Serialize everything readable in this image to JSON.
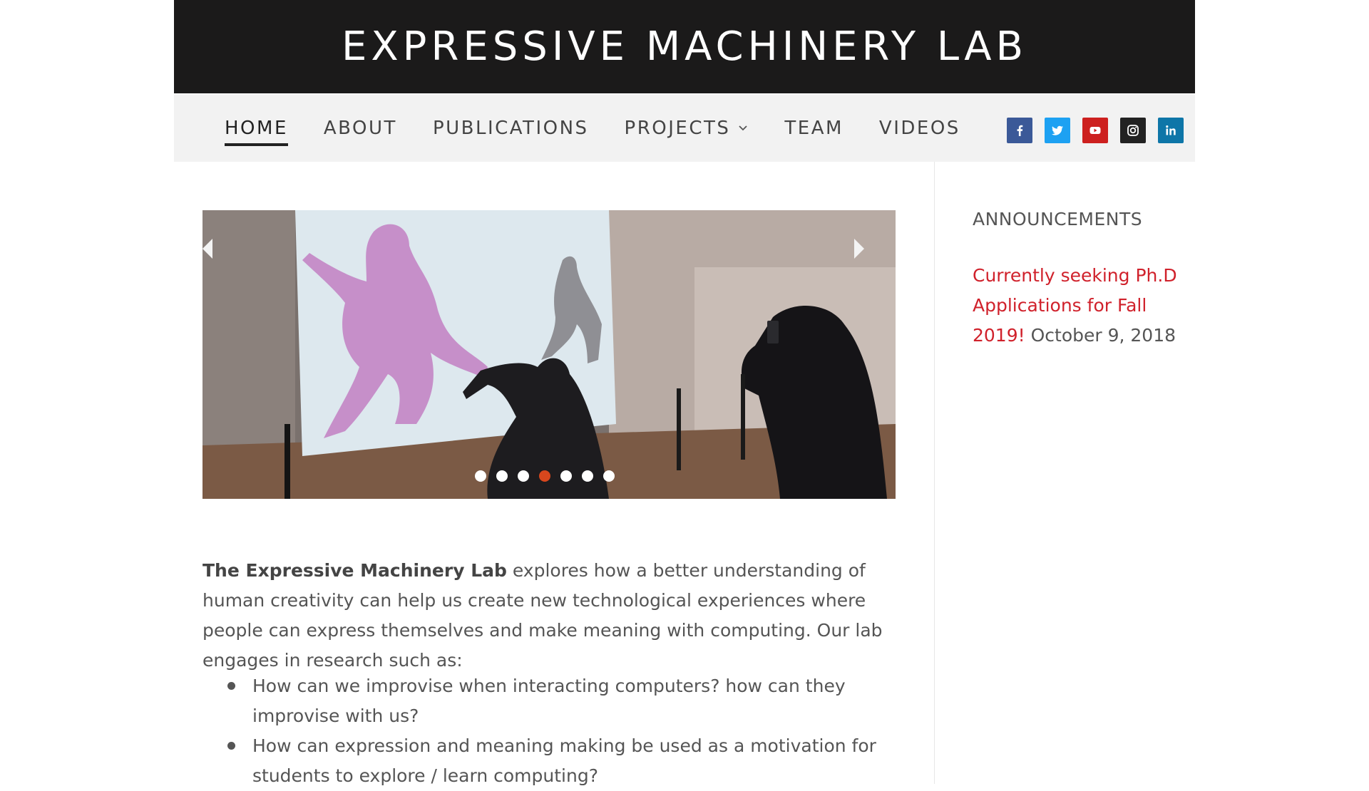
{
  "header": {
    "title": "EXPRESSIVE MACHINERY LAB"
  },
  "nav": {
    "items": [
      {
        "label": "HOME"
      },
      {
        "label": "ABOUT"
      },
      {
        "label": "PUBLICATIONS"
      },
      {
        "label": "PROJECTS"
      },
      {
        "label": "TEAM"
      },
      {
        "label": "VIDEOS"
      }
    ],
    "active": "HOME"
  },
  "social": [
    {
      "name": "facebook",
      "color": "#3b5998",
      "glyph": "f"
    },
    {
      "name": "twitter",
      "color": "#1da1f2",
      "glyph": ""
    },
    {
      "name": "youtube",
      "color": "#cd201f",
      "glyph": ""
    },
    {
      "name": "instagram",
      "color": "#222222",
      "glyph": ""
    },
    {
      "name": "linkedin",
      "color": "#0e76a8",
      "glyph": "in"
    }
  ],
  "slider": {
    "slide_count": 7,
    "active_index": 3
  },
  "intro": {
    "bold": "The Expressive Machinery Lab",
    "text": " explores how a better understanding of human creativity can help us create new technological experiences where people can express themselves and make meaning with computing.  Our lab engages in research such as:"
  },
  "bullets": [
    "How can we improvise when interacting computers?  how can they improvise with us?",
    "How can expression and meaning making be used as a motivation for students to explore / learn computing?"
  ],
  "sidebar": {
    "widget_title": "ANNOUNCEMENTS",
    "announcement_link": "Currently seeking Ph.D Applications for Fall 2019!",
    "announcement_date": "October 9, 2018"
  },
  "colors": {
    "header_bg": "#1b1a1a",
    "nav_bg": "#f2f2f2",
    "link_red": "#d0212b",
    "active_dot": "#d8471d"
  }
}
